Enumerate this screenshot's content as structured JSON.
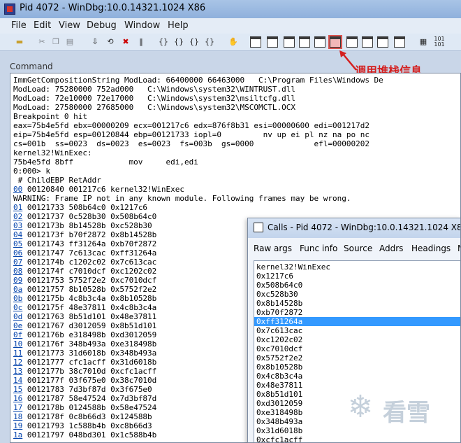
{
  "window": {
    "title": "Pid 4072 - WinDbg:10.0.14321.1024 X86"
  },
  "menu": [
    "File",
    "Edit",
    "View",
    "Debug",
    "Window",
    "Help"
  ],
  "toolbar_icons": [
    "open-icon",
    "cut-icon",
    "copy-icon",
    "paste-icon",
    "go-icon",
    "restart-icon",
    "stop-debugging-icon",
    "break-icon",
    "step-into-icon",
    "step-over-icon",
    "step-out-icon",
    "run-to-cursor-icon",
    "hand-icon",
    "command-window-icon",
    "watch-window-icon",
    "locals-window-icon",
    "registers-window-icon",
    "memory-window-icon",
    "call-stack-window-icon",
    "disassembly-window-icon",
    "scratch-pad-icon",
    "processes-threads-icon",
    "source-mode-icon",
    "font-icon"
  ],
  "command_window": {
    "label": "Command",
    "lines": [
      "ImmGetCompositionString ModLoad: 66400000 66463000   C:\\Program Files\\Windows De",
      "ModLoad: 75280000 752ad000   C:\\Windows\\system32\\WINTRUST.dll",
      "ModLoad: 72e10000 72e17000   C:\\Windows\\system32\\msiltcfg.dll",
      "ModLoad: 27580000 27685000   C:\\Windows\\system32\\MSCOMCTL.OCX",
      "Breakpoint 0 hit",
      "eax=75b4e5fd ebx=00000209 ecx=001217c6 edx=876f8b31 esi=00000600 edi=001217d2",
      "eip=75b4e5fd esp=00120844 ebp=00121733 iopl=0         nv up ei pl nz na po nc",
      "cs=001b  ss=0023  ds=0023  es=0023  fs=003b  gs=0000             efl=00000202",
      "kernel32!WinExec:",
      "75b4e5fd 8bff            mov     edi,edi",
      "0:000> k",
      " # ChildEBP RetAddr",
      "@00 00120840 001217c6 kernel32!WinExec",
      "WARNING: Frame IP not in any known module. Following frames may be wrong.",
      "@01 00121733 508b64c0 0x1217c6",
      "@02 00121737 0c528b30 0x508b64c0",
      "@03 0012173b 8b14528b 0xc528b30",
      "@04 0012173f b70f2872 0x8b14528b",
      "@05 00121743 ff31264a 0xb70f2872",
      "@06 00121747 7c613cac 0xff31264a",
      "@07 0012174b c1202c02 0x7c613cac",
      "@08 0012174f c7010dcf 0xc1202c02",
      "@09 00121753 5752f2e2 0xc7010dcf",
      "@0a 00121757 8b10528b 0x5752f2e2",
      "@0b 0012175b 4c8b3c4a 0x8b10528b",
      "@0c 0012175f 48e37811 0x4c8b3c4a",
      "@0d 00121763 8b51d101 0x48e37811",
      "@0e 00121767 d3012059 0x8b51d101",
      "@0f 0012176b e318498b 0xd3012059",
      "@10 0012176f 348b493a 0xe318498b",
      "@11 00121773 31d6018b 0x348b493a",
      "@12 00121777 cfc1acff 0x31d6018b",
      "@13 0012177b 38c7010d 0xcfc1acff",
      "@14 0012177f 03f675e0 0x38c7010d",
      "@15 00121783 7d3bf87d 0x3f675e0",
      "@16 00121787 58e47524 0x7d3bf87d",
      "@17 0012178b 0124588b 0x58e47524",
      "@18 0012178f 0c8b66d3 0x124588b",
      "@19 00121793 1c588b4b 0xc8b66d3",
      "@1a 00121797 048bd301 0x1c588b4b"
    ]
  },
  "annotation": {
    "text": "调用堆栈信息"
  },
  "calls_window": {
    "title": "Calls - Pid 4072 - WinDbg:10.0.14321.1024 X86",
    "buttons": [
      "Raw args",
      "Func info",
      "Source",
      "Addrs",
      "Headings",
      "N"
    ],
    "items": [
      "kernel32!WinExec",
      "0x1217c6",
      "0x508b64c0",
      "0xc528b30",
      "0x8b14528b",
      "0xb70f2872",
      "0xff31264a",
      "0x7c613cac",
      "0xc1202c02",
      "0xc7010dcf",
      "0x5752f2e2",
      "0x8b10528b",
      "0x4c8b3c4a",
      "0x48e37811",
      "0x8b51d101",
      "0xd3012059",
      "0xe318498b",
      "0x348b493a",
      "0x31d6018b",
      "0xcfc1acff"
    ],
    "selected_index": 6
  },
  "watermark": {
    "text": "看雪"
  }
}
